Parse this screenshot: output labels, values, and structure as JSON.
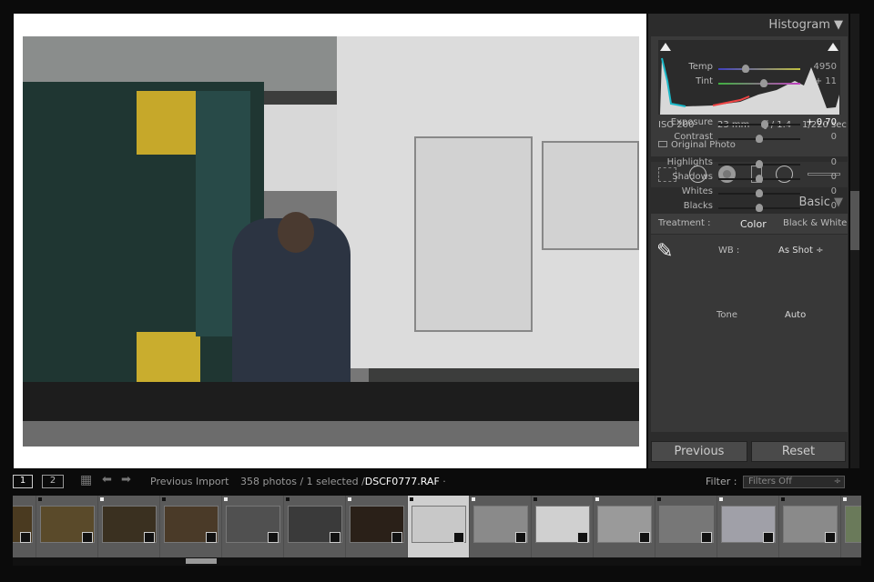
{
  "histogram": {
    "title": "Histogram",
    "iso": "ISO 200",
    "focal_length": "23 mm",
    "aperture": "ƒ / 1.4",
    "shutter": "1/220 sec",
    "original_photo_label": "Original Photo"
  },
  "tools": [
    "crop-overlay-icon",
    "spot-removal-icon",
    "red-eye-icon",
    "graduated-filter-icon",
    "radial-filter-icon",
    "adjustment-brush-icon"
  ],
  "basic": {
    "title": "Basic",
    "treatment_label": "Treatment :",
    "treatment_color": "Color",
    "treatment_bw": "Black & White",
    "wb_label": "WB :",
    "wb_value": "As Shot ÷",
    "tone_label": "Tone",
    "auto_label": "Auto",
    "sliders": [
      {
        "label": "Temp",
        "value": "4950",
        "position": 0.33
      },
      {
        "label": "Tint",
        "value": "+ 11",
        "position": 0.55
      },
      {
        "label": "Exposure",
        "value": "+ 0.70",
        "position": 0.57
      },
      {
        "label": "Contrast",
        "value": "0",
        "position": 0.5
      },
      {
        "label": "Highlights",
        "value": "0",
        "position": 0.5
      },
      {
        "label": "Shadows",
        "value": "0",
        "position": 0.5
      },
      {
        "label": "Whites",
        "value": "0",
        "position": 0.5
      },
      {
        "label": "Blacks",
        "value": "0",
        "position": 0.5
      }
    ],
    "previous_label": "Previous",
    "reset_label": "Reset"
  },
  "toolbar": {
    "view1": "1",
    "view2": "2",
    "source": "Previous Import",
    "count": "358 photos / 1 selected /",
    "filename": "DSCF0777.RAF",
    "filename_suffix": " ·",
    "filter_label": "Filter :",
    "filter_value": "Filters Off"
  },
  "colors": {
    "panel": "#2c2c2c",
    "accent_selected": "#cfcfcf"
  }
}
